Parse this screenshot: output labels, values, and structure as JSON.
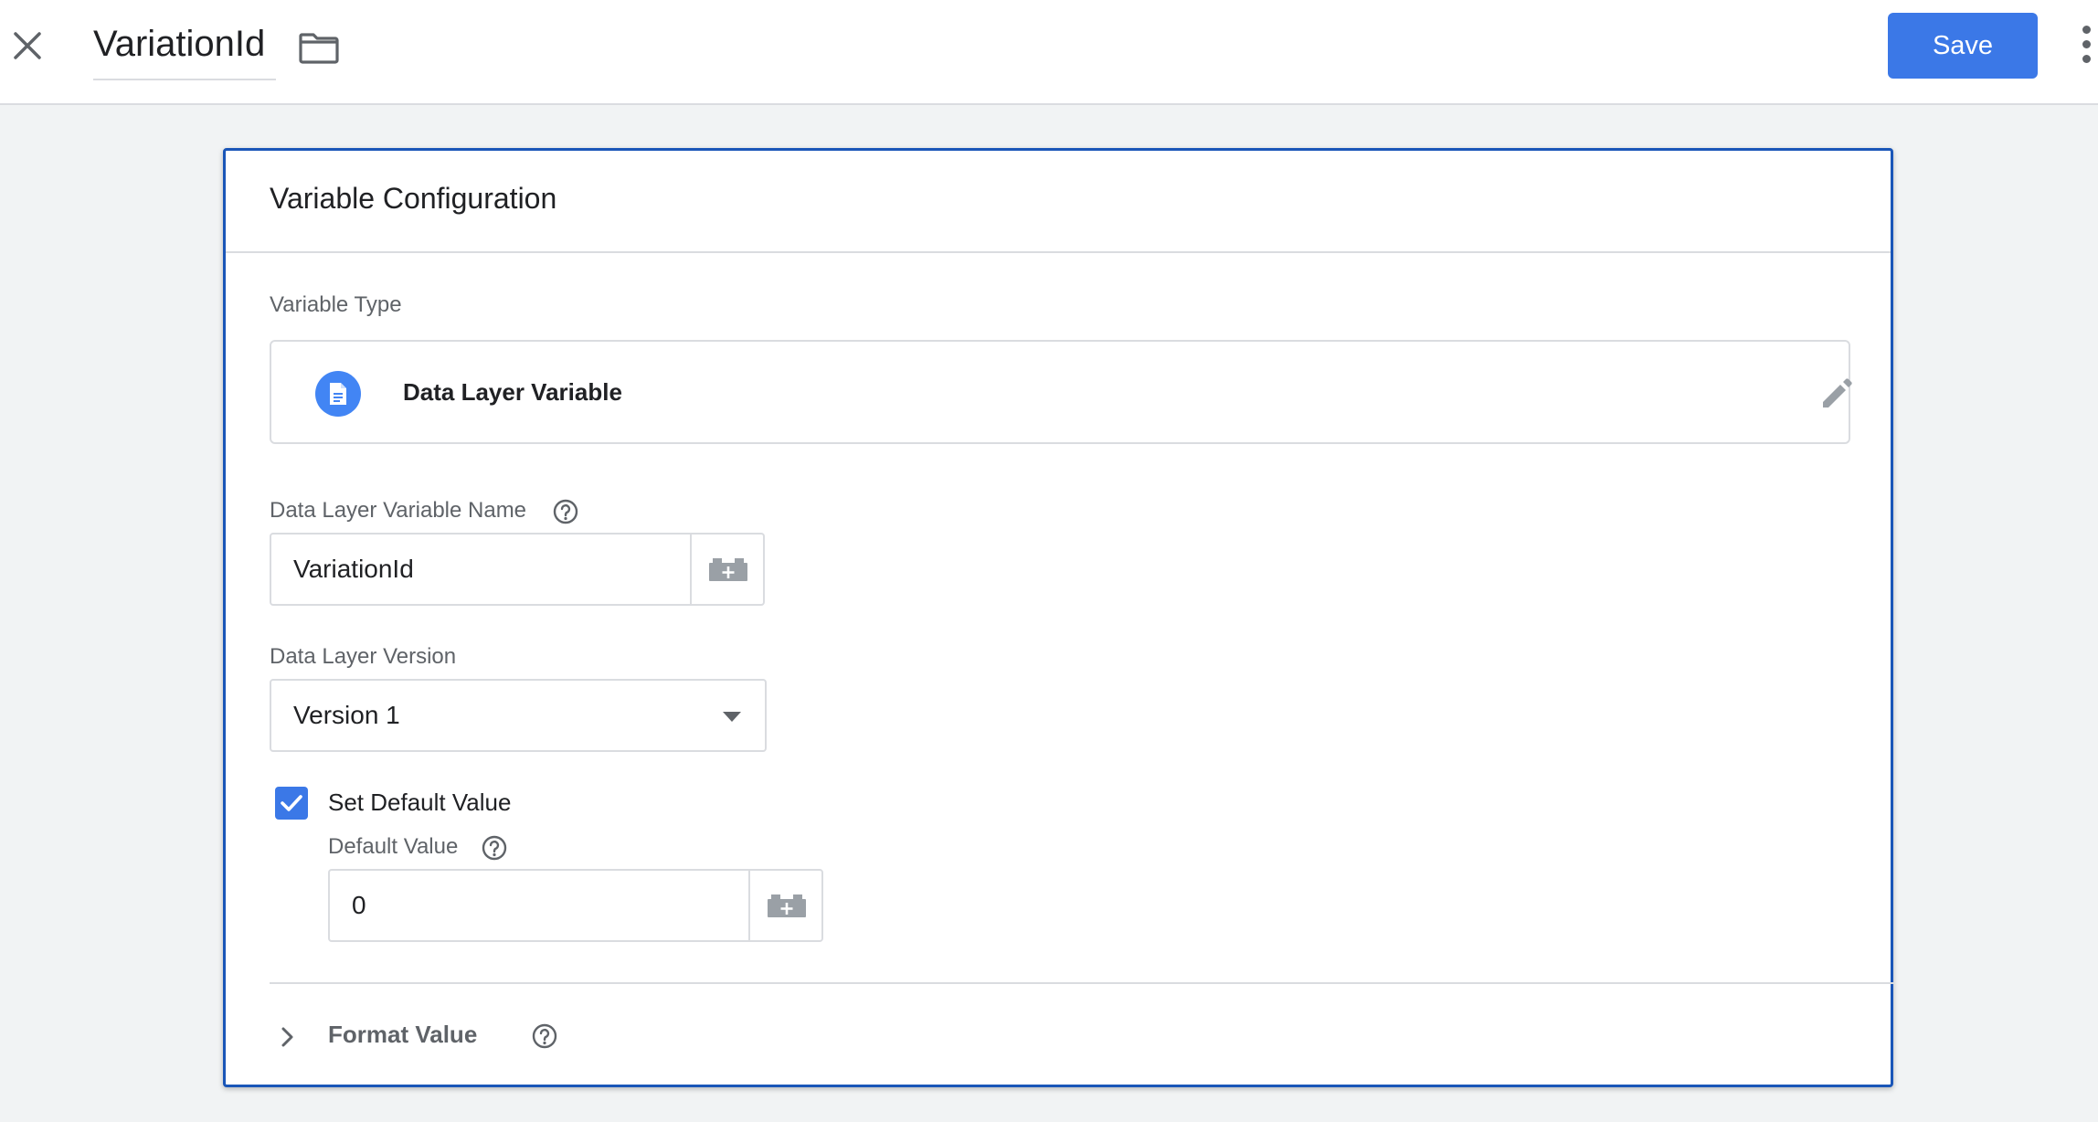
{
  "header": {
    "close_icon": "close-icon",
    "title": "VariationId",
    "folder_icon": "folder-icon",
    "save_label": "Save",
    "more_icon": "more-vert-icon"
  },
  "card": {
    "title": "Variable Configuration",
    "variable_type": {
      "label": "Variable Type",
      "name": "Data Layer Variable",
      "icon": "document-icon",
      "edit_icon": "pencil-icon"
    },
    "dl_variable_name": {
      "label": "Data Layer Variable Name",
      "value": "VariationId",
      "help_icon": "help-icon",
      "variable_picker_icon": "brick-plus-icon"
    },
    "dl_version": {
      "label": "Data Layer Version",
      "selected": "Version 1"
    },
    "default_value": {
      "checkbox_label": "Set Default Value",
      "checked": true,
      "label": "Default Value",
      "value": "0",
      "help_icon": "help-icon",
      "variable_picker_icon": "brick-plus-icon"
    },
    "format_value": {
      "label": "Format Value",
      "chevron_icon": "chevron-right-icon",
      "help_icon": "help-icon"
    }
  },
  "colors": {
    "accent": "#3b78e7",
    "card_border": "#1a56b8",
    "background": "#f1f3f4",
    "type_icon": "#4285f4"
  }
}
